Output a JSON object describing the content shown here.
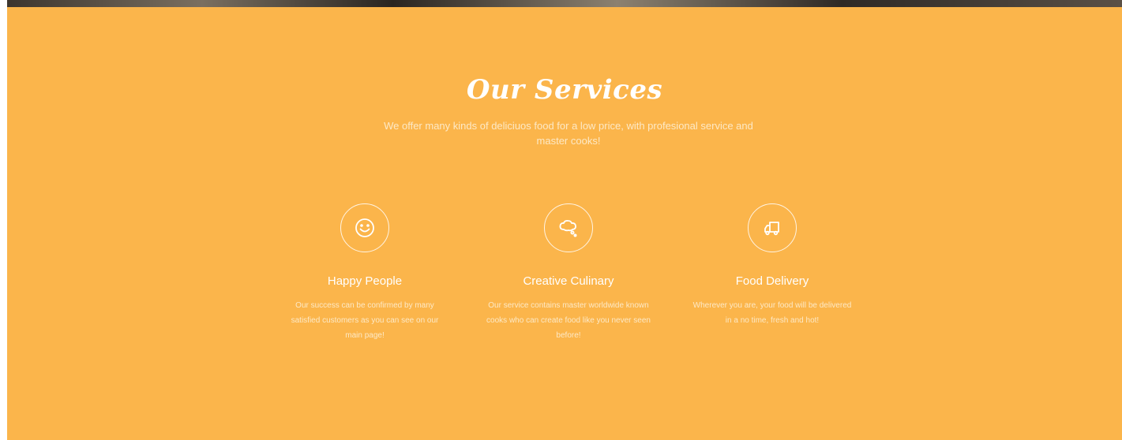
{
  "colors": {
    "section_background": "#fbb54b",
    "title_text": "#ffffff",
    "body_text": "#fde9c6"
  },
  "services": {
    "title": "Our Services",
    "subtitle": "We offer many kinds of deliciuos food for a low price, with profesional service and master cooks!",
    "items": [
      {
        "icon": "smiley-icon",
        "title": "Happy People",
        "text": "Our success can be confirmed by many satisfied customers as you can see on our main page!"
      },
      {
        "icon": "thought-bubble-icon",
        "title": "Creative Culinary",
        "text": "Our service contains master worldwide known cooks who can create food like you never seen before!"
      },
      {
        "icon": "delivery-truck-icon",
        "title": "Food Delivery",
        "text": "Wherever you are, your food will be delivered in a no time, fresh and hot!"
      }
    ]
  }
}
